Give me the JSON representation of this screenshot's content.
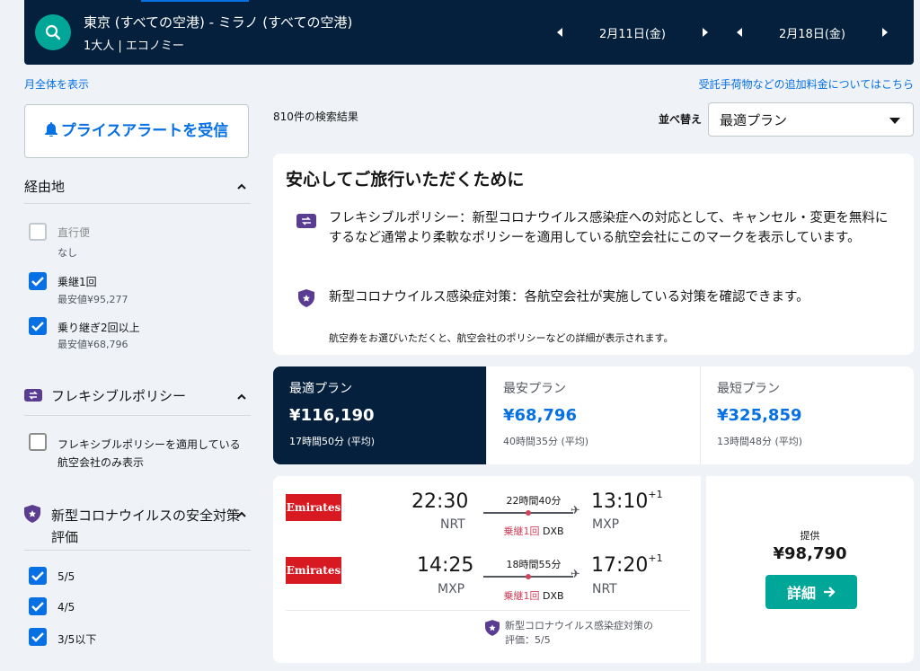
{
  "header": {
    "route": "東京 (すべての空港) - ミラノ (すべての空港)",
    "passengers": "1大人 | エコノミー",
    "depart_date": "2月11日(金)",
    "return_date": "2月18日(金)"
  },
  "links": {
    "month_view": "月全体を表示",
    "baggage_fees": "受託手荷物などの追加料金についてはこちら"
  },
  "sidebar": {
    "price_alert": "プライスアラートを受信",
    "stops": {
      "title": "経由地",
      "options": [
        {
          "label": "直行便",
          "sub": "なし",
          "checked": false,
          "disabled": true
        },
        {
          "label": "乗継1回",
          "sub": "最安値¥95,277",
          "checked": true
        },
        {
          "label": "乗り継ぎ2回以上",
          "sub": "最安値¥68,796",
          "checked": true
        }
      ]
    },
    "flex": {
      "title": "フレキシブルポリシー",
      "option": "フレキシブルポリシーを適用している航空会社のみ表示"
    },
    "covid": {
      "title": "新型コロナウイルスの安全対策評価",
      "options": [
        {
          "label": "5/5",
          "checked": true
        },
        {
          "label": "4/5",
          "checked": true
        },
        {
          "label": "3/5以下",
          "checked": true
        }
      ]
    }
  },
  "results": {
    "count": "810件の検索結果",
    "sort_label": "並べ替え",
    "sort_value": "最適プラン"
  },
  "info": {
    "title": "安心してご旅行いただくために",
    "flex_text": "フレキシブルポリシー：新型コロナウイルス感染症への対応として、キャンセル・変更を無料にするなど通常より柔軟なポリシーを適用している航空会社にこのマークを表示しています。",
    "covid_text": "新型コロナウイルス感染症対策：各航空会社が実施している対策を確認できます。",
    "footnote": "航空券をお選びいただくと、航空会社のポリシーなどの詳細が表示されます。"
  },
  "tabs": [
    {
      "name": "最適プラン",
      "price": "¥116,190",
      "duration": "17時間50分 (平均)"
    },
    {
      "name": "最安プラン",
      "price": "¥68,796",
      "duration": "40時間35分 (平均)"
    },
    {
      "name": "最短プラン",
      "price": "¥325,859",
      "duration": "13時間48分 (平均)"
    }
  ],
  "flight": {
    "airline": "Emirates",
    "legs": [
      {
        "dep_time": "22:30",
        "dep_ap": "NRT",
        "arr_time": "13:10",
        "arr_plus": "+1",
        "arr_ap": "MXP",
        "duration": "22時間40分",
        "stops": "乗継1回",
        "via": "DXB"
      },
      {
        "dep_time": "14:25",
        "dep_ap": "MXP",
        "arr_time": "17:20",
        "arr_plus": "+1",
        "arr_ap": "NRT",
        "duration": "18時間55分",
        "stops": "乗継1回",
        "via": "DXB"
      }
    ],
    "covid_note_1": "新型コロナウイルス感染症対策の",
    "covid_note_2": "評価：5/5",
    "provider_label": "提供",
    "price": "¥98,790",
    "details": "詳細"
  },
  "colors": {
    "navy": "#05203c",
    "blue": "#0770e3",
    "teal": "#00a698",
    "red": "#d1435b",
    "emirates": "#d71921"
  }
}
